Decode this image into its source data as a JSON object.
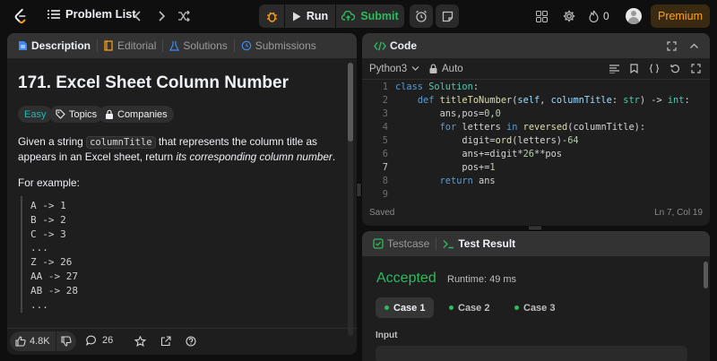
{
  "topbar": {
    "problem_list_label": "Problem List",
    "run_label": "Run",
    "submit_label": "Submit",
    "streak_count": "0",
    "premium_label": "Premium"
  },
  "left_panel": {
    "tabs": [
      {
        "label": "Description",
        "icon": "document-icon"
      },
      {
        "label": "Editorial",
        "icon": "book-icon"
      },
      {
        "label": "Solutions",
        "icon": "flask-icon"
      },
      {
        "label": "Submissions",
        "icon": "history-icon"
      }
    ],
    "title": "171. Excel Sheet Column Number",
    "difficulty": "Easy",
    "topics_label": "Topics",
    "companies_label": "Companies",
    "desc_before": "Given a string ",
    "desc_code": "columnTitle",
    "desc_after": " that represents the column title as appears in an Excel sheet, return ",
    "desc_em": "its corresponding column number",
    "desc_end": ".",
    "example_label": "For example:",
    "example_lines": [
      "A -> 1",
      "B -> 2",
      "C -> 3",
      "...",
      "Z -> 26",
      "AA -> 27",
      "AB -> 28",
      "..."
    ],
    "likes": "4.8K",
    "comments": "26"
  },
  "code_panel": {
    "title": "Code",
    "language": "Python3",
    "mode": "Auto",
    "status": "Saved",
    "cursor": "Ln 7, Col 19",
    "lines": [
      "class Solution:",
      "    def titleToNumber(self, columnTitle: str) -> int:",
      "        ans,pos=0,0",
      "        for letters in reversed(columnTitle):",
      "            digit=ord(letters)-64",
      "            ans+=digit*26**pos",
      "            pos+=1",
      "        return ans",
      ""
    ]
  },
  "result_panel": {
    "tab_testcase": "Testcase",
    "tab_result": "Test Result",
    "verdict": "Accepted",
    "runtime": "Runtime: 49 ms",
    "cases": [
      "Case 1",
      "Case 2",
      "Case 3"
    ],
    "input_label": "Input"
  },
  "colors": {
    "accent": "#ffa116",
    "success": "#2cbb5d",
    "panel": "#1e1e1e",
    "background": "#0f0f0f"
  }
}
